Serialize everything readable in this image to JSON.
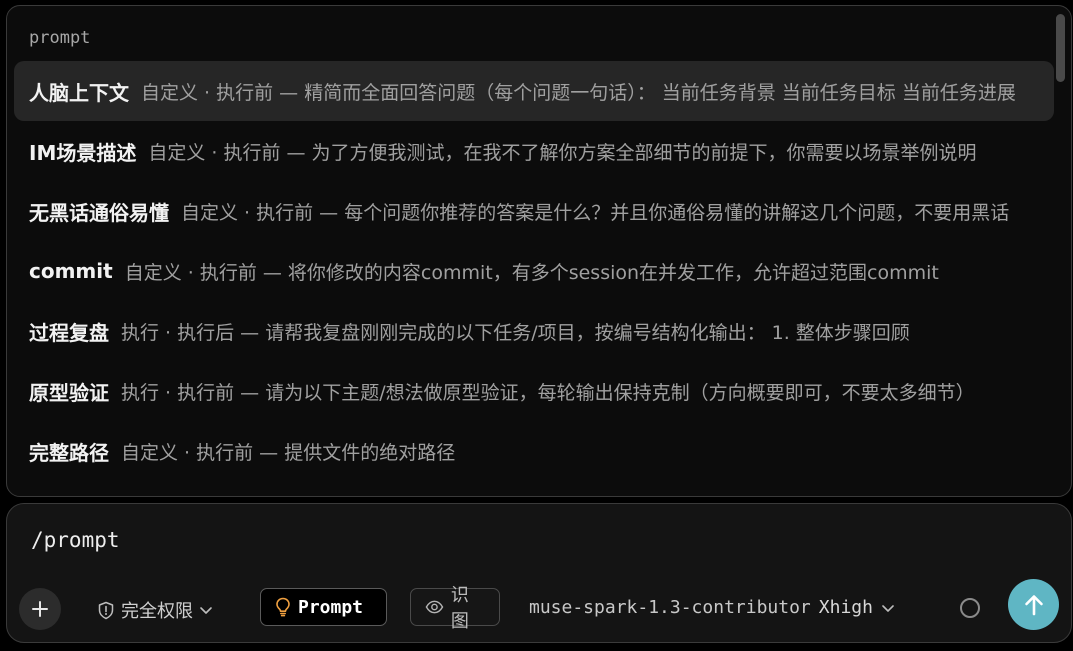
{
  "popup": {
    "title": "prompt",
    "items": [
      {
        "name": "人脑上下文",
        "desc": "自定义 · 执行前 — 精简而全面回答问题（每个问题一句话）： 当前任务背景 当前任务目标 当前任务进展",
        "selected": true
      },
      {
        "name": "IM场景描述",
        "desc": "自定义 · 执行前 — 为了方便我测试，在我不了解你方案全部细节的前提下，你需要以场景举例说明",
        "selected": false
      },
      {
        "name": "无黑话通俗易懂",
        "desc": "自定义 · 执行前 — 每个问题你推荐的答案是什么？并且你通俗易懂的讲解这几个问题，不要用黑话",
        "selected": false
      },
      {
        "name": "commit",
        "desc": "自定义 · 执行前 — 将你修改的内容commit，有多个session在并发工作，允许超过范围commit",
        "selected": false
      },
      {
        "name": "过程复盘",
        "desc": "执行 · 执行后 — 请帮我复盘刚刚完成的以下任务/项目，按编号结构化输出： 1. 整体步骤回顾",
        "selected": false
      },
      {
        "name": "原型验证",
        "desc": "执行 · 执行前 — 请为以下主题/想法做原型验证，每轮输出保持克制（方向概要即可，不要太多细节）",
        "selected": false
      },
      {
        "name": "完整路径",
        "desc": "自定义 · 执行前 — 提供文件的绝对路径",
        "selected": false
      }
    ]
  },
  "composer": {
    "input_value": "/prompt",
    "permission_label": "完全权限",
    "prompt_chip_label": "Prompt",
    "vision_chip_label": "识图",
    "model_name": "muse-spark-1.3-contributor",
    "effort_label": "Xhigh"
  },
  "colors": {
    "accent_send": "#5fb6c4",
    "prompt_icon": "#f0a040"
  },
  "icons": {
    "plus": "plus-icon",
    "permission": "shield-icon",
    "prompt": "lightbulb-icon",
    "vision": "eye-icon",
    "chevron": "chevron-down-icon",
    "status": "spinner-icon",
    "send": "arrow-up-icon"
  }
}
